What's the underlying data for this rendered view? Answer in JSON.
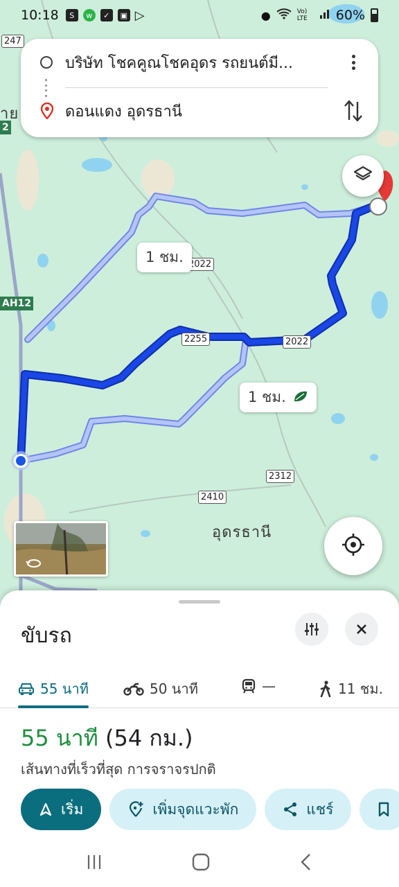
{
  "status_bar": {
    "time": "10:18",
    "battery": "60%",
    "network": "Vo) LTE"
  },
  "search": {
    "origin": "บริษัท โชคคูณโชคอุดร รถยนต์มี...",
    "destination": "ดอนแดง อุดรธานี"
  },
  "map": {
    "route_label_1": "1 ชม.",
    "route_label_2": "1 ชม.",
    "city_label": "อุดรธานี",
    "edge_label": "าย",
    "shields": {
      "s247": "247",
      "s2": "2",
      "ah12": "AH12",
      "s2022a": "2022",
      "s2255": "2255",
      "s2022b": "2022",
      "s2312": "2312",
      "s2410": "2410"
    }
  },
  "sheet": {
    "title": "ขับรถ",
    "modes": [
      {
        "icon": "car-icon",
        "label": "55 นาที"
      },
      {
        "icon": "motorcycle-icon",
        "label": "50 นาที"
      },
      {
        "icon": "train-icon",
        "label": "—"
      },
      {
        "icon": "walk-icon",
        "label": "11 ชม."
      }
    ],
    "duration": "55 นาที",
    "distance": "(54 กม.)",
    "description": "เส้นทางที่เร็วที่สุด การจราจรปกติ",
    "actions": {
      "start": "เริ่ม",
      "add_stop": "เพิ่มจุดแวะพัก",
      "share": "แชร์"
    }
  },
  "colors": {
    "accent": "#0b6e7e",
    "time_green": "#1e8e3e",
    "route_primary": "#1a47e6",
    "route_alt": "#9fb4f5"
  }
}
